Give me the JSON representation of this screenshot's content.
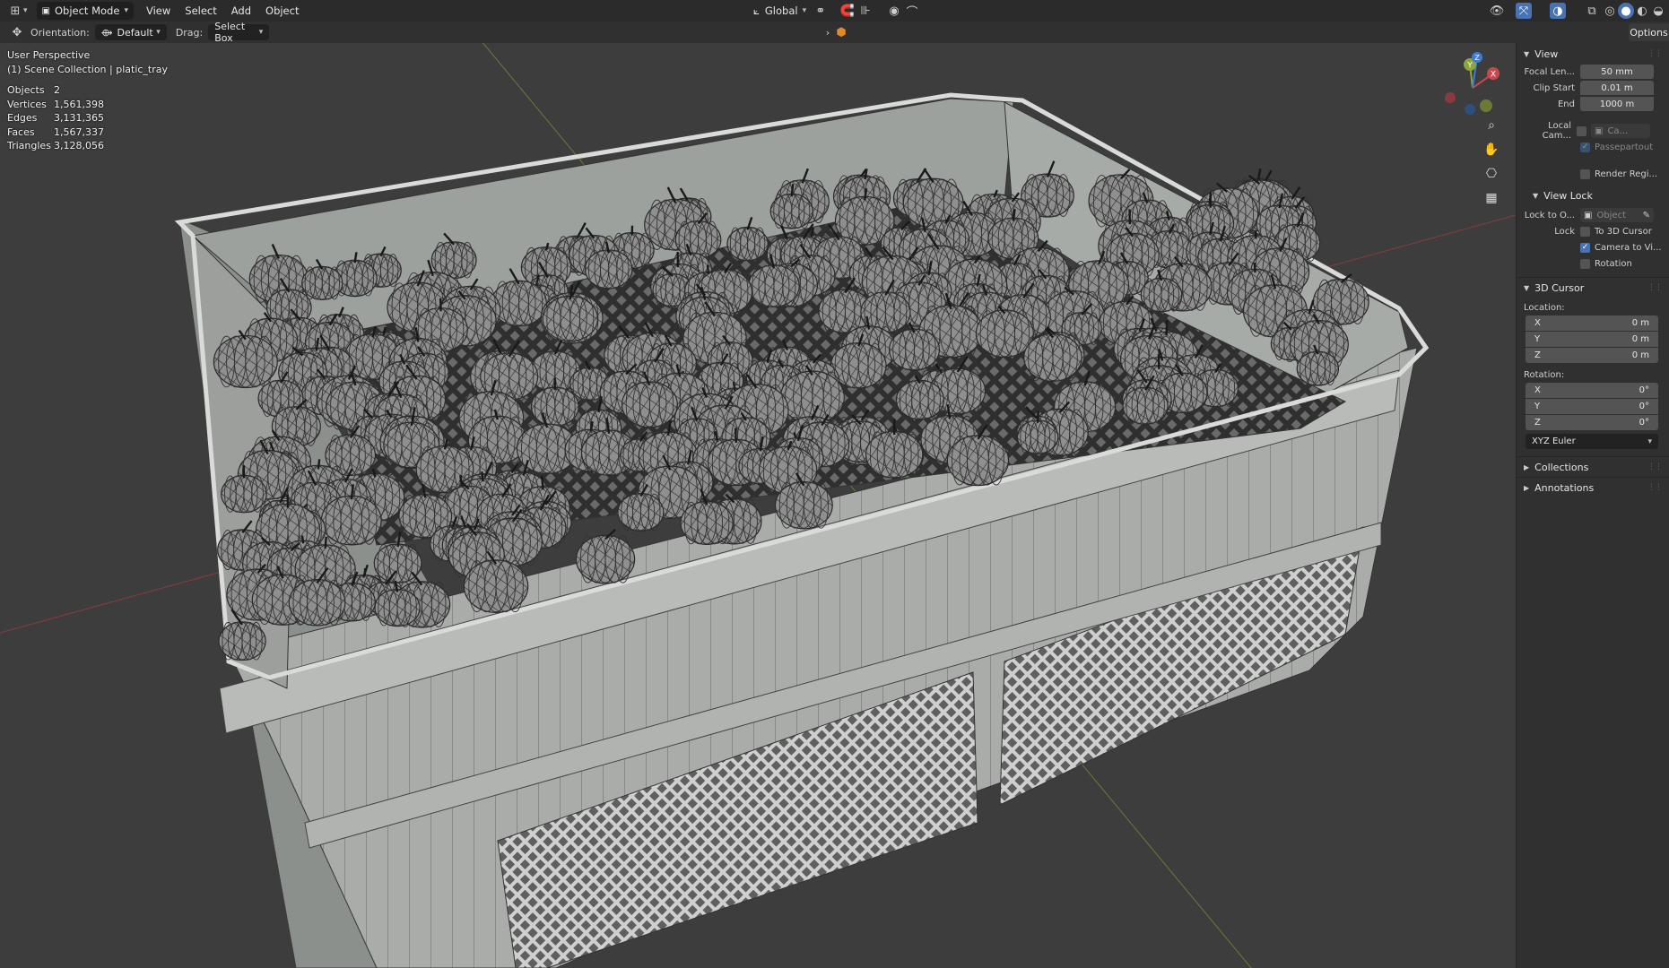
{
  "header": {
    "mode": "Object Mode",
    "menus": [
      "View",
      "Select",
      "Add",
      "Object"
    ],
    "transform_orientation": "Global"
  },
  "toolbar": {
    "orientation_label": "Orientation:",
    "orientation_value": "Default",
    "drag_label": "Drag:",
    "drag_value": "Select Box"
  },
  "viewport": {
    "perspective": "User Perspective",
    "collection": "(1) Scene Collection | platic_tray",
    "stats": [
      {
        "label": "Objects",
        "value": "2"
      },
      {
        "label": "Vertices",
        "value": "1,561,398"
      },
      {
        "label": "Edges",
        "value": "3,131,365"
      },
      {
        "label": "Faces",
        "value": "1,567,337"
      },
      {
        "label": "Triangles",
        "value": "3,128,056"
      }
    ],
    "gizmo": {
      "x": "X",
      "y": "Y",
      "z": "Z"
    }
  },
  "sidebar": {
    "tab": "Options",
    "view": {
      "title": "View",
      "focal_label": "Focal Len...",
      "focal_value": "50 mm",
      "clip_start_label": "Clip Start",
      "clip_start_value": "0.01 m",
      "end_label": "End",
      "end_value": "1000 m",
      "local_camera_label": "Local Cam...",
      "local_camera_value": "Ca...",
      "passepartout": "Passepartout",
      "render_region": "Render Regi..."
    },
    "view_lock": {
      "title": "View Lock",
      "lock_to_label": "Lock to O...",
      "lock_to_placeholder": "Object",
      "lock_label": "Lock",
      "to_3d_cursor": "To 3D Cursor",
      "camera_to_view": "Camera to Vi...",
      "rotation": "Rotation"
    },
    "cursor": {
      "title": "3D Cursor",
      "location_label": "Location:",
      "location": [
        {
          "axis": "X",
          "value": "0 m"
        },
        {
          "axis": "Y",
          "value": "0 m"
        },
        {
          "axis": "Z",
          "value": "0 m"
        }
      ],
      "rotation_label": "Rotation:",
      "rotation": [
        {
          "axis": "X",
          "value": "0°"
        },
        {
          "axis": "Y",
          "value": "0°"
        },
        {
          "axis": "Z",
          "value": "0°"
        }
      ],
      "rotation_mode": "XYZ Euler"
    },
    "collections": "Collections",
    "annotations": "Annotations"
  },
  "colors": {
    "x_axis": "#c8484e",
    "y_axis": "#8aa63c",
    "z_axis": "#3c7bd8",
    "accent": "#4772b3"
  }
}
